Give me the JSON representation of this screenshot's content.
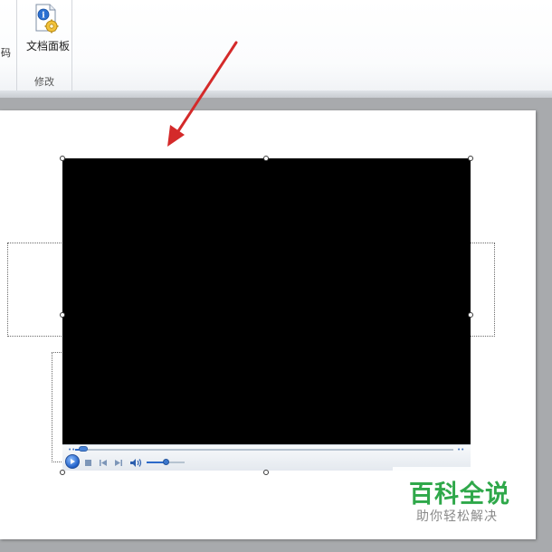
{
  "ribbon": {
    "truncated_label": "码",
    "document_panel_button": {
      "label": "文档面板",
      "icon": "document-info-gear-icon"
    },
    "group_label": "修改"
  },
  "media_player": {
    "seek_progress": 0.02,
    "volume_level": 0.5,
    "icons": [
      "play-icon",
      "stop-icon",
      "previous-icon",
      "next-icon",
      "volume-icon"
    ]
  },
  "colors": {
    "arrow": "#d42a2a",
    "video_background": "#000000",
    "watermark_green": "#2fa84a",
    "watermark_gray": "#8a8a8a"
  },
  "watermark": {
    "title": "百科全说",
    "subtitle": "助你轻松解决"
  }
}
